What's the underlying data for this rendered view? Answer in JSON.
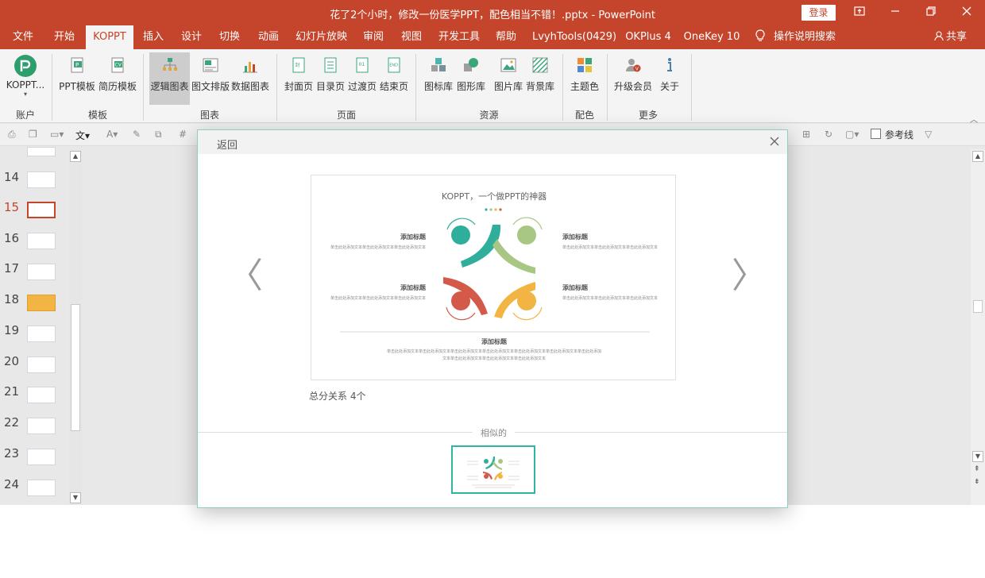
{
  "window": {
    "title": "花了2个小时，修改一份医学PPT，配色相当不错！.pptx  -  PowerPoint",
    "login": "登录",
    "icons": [
      "restore-ribbon-icon",
      "minimize-icon",
      "maximize-icon",
      "close-icon"
    ]
  },
  "menu": {
    "tabs": [
      "文件",
      "开始",
      "KOPPT",
      "插入",
      "设计",
      "切换",
      "动画",
      "幻灯片放映",
      "审阅",
      "视图",
      "开发工具",
      "帮助",
      "LvyhTools(0429)",
      "OKPlus 4",
      "OneKey 10"
    ],
    "active": "KOPPT",
    "search": "操作说明搜索",
    "share": "共享"
  },
  "ribbon": {
    "account": {
      "label": "KOPPT...",
      "group": "账户"
    },
    "templates": {
      "items": [
        "PPT模板",
        "简历模板"
      ],
      "group": "模板"
    },
    "charts": {
      "items": [
        "逻辑图表",
        "图文排版",
        "数据图表"
      ],
      "group": "图表",
      "selected": "逻辑图表"
    },
    "pages": {
      "items": [
        "封面页",
        "目录页",
        "过渡页",
        "结束页"
      ],
      "group": "页面"
    },
    "resources": {
      "items": [
        "图标库",
        "图形库",
        "图片库",
        "背景库"
      ],
      "group": "资源"
    },
    "color": {
      "items": [
        "主题色"
      ],
      "group": "配色"
    },
    "more": {
      "items": [
        "升级会员",
        "关于"
      ],
      "group": "更多"
    }
  },
  "toolbar": {
    "guide_label": "参考线"
  },
  "slides": {
    "numbers": [
      "14",
      "15",
      "16",
      "17",
      "18",
      "19",
      "20",
      "21",
      "22",
      "23",
      "24"
    ],
    "current": "15"
  },
  "modal": {
    "back": "返回",
    "prev": "〈",
    "next": "〉",
    "preview": {
      "title": "KOPPT，一个做PPT的神器",
      "heading": "添加标题",
      "body": "单击此处添加文本单击此处添加文本单击此处添加文本",
      "bottom_heading": "添加标题",
      "bottom_body1": "单击此处添加文本单击此处添加文本单击此处添加文本单击此处添加文本单击此处添加文本单击此处添加文本单击此处添加",
      "bottom_body2": "文本单击此处添加文本单击此处添加文本单击此处添加文本"
    },
    "caption": "总分关系 4个",
    "similar_label": "相似的"
  },
  "colors": {
    "brand": "#c4452b",
    "teal": "#2fae9b",
    "green": "#a8c785",
    "red": "#d35a48",
    "yellow": "#f2b544"
  }
}
